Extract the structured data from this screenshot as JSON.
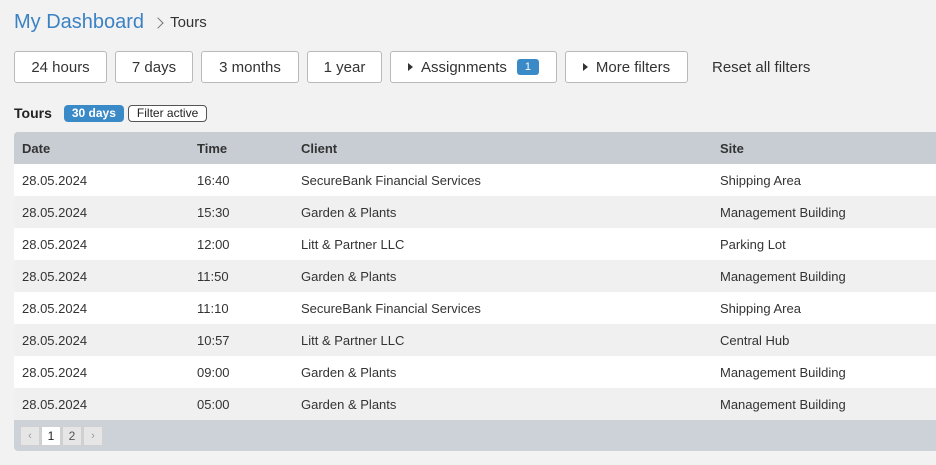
{
  "breadcrumb": {
    "root": "My Dashboard",
    "current": "Tours"
  },
  "filters": {
    "buttons": [
      {
        "label": "24 hours"
      },
      {
        "label": "7 days"
      },
      {
        "label": "3 months"
      },
      {
        "label": "1 year"
      }
    ],
    "assignments": {
      "label": "Assignments",
      "count": "1"
    },
    "more_filters": {
      "label": "More filters"
    },
    "reset": "Reset all filters"
  },
  "section": {
    "title": "Tours",
    "range_badge": "30 days",
    "filter_badge": "Filter active"
  },
  "table": {
    "columns": {
      "date": "Date",
      "time": "Time",
      "client": "Client",
      "site": "Site"
    },
    "rows": [
      {
        "date": "28.05.2024",
        "time": "16:40",
        "client": "SecureBank Financial Services",
        "site": "Shipping Area"
      },
      {
        "date": "28.05.2024",
        "time": "15:30",
        "client": "Garden & Plants",
        "site": "Management Building"
      },
      {
        "date": "28.05.2024",
        "time": "12:00",
        "client": "Litt & Partner LLC",
        "site": "Parking Lot"
      },
      {
        "date": "28.05.2024",
        "time": "11:50",
        "client": "Garden & Plants",
        "site": "Management Building"
      },
      {
        "date": "28.05.2024",
        "time": "11:10",
        "client": "SecureBank Financial Services",
        "site": "Shipping Area"
      },
      {
        "date": "28.05.2024",
        "time": "10:57",
        "client": "Litt & Partner LLC",
        "site": "Central Hub"
      },
      {
        "date": "28.05.2024",
        "time": "09:00",
        "client": "Garden & Plants",
        "site": "Management Building"
      },
      {
        "date": "28.05.2024",
        "time": "05:00",
        "client": "Garden & Plants",
        "site": "Management Building"
      }
    ]
  },
  "pagination": {
    "prev": "‹",
    "pages": [
      "1",
      "2"
    ],
    "current": "1",
    "next": "›"
  },
  "colors": {
    "accent": "#3b8ac8",
    "breadcrumb_link": "#3b82c4",
    "table_header": "#c8cdd3",
    "row_alt": "#f0f0f0"
  }
}
